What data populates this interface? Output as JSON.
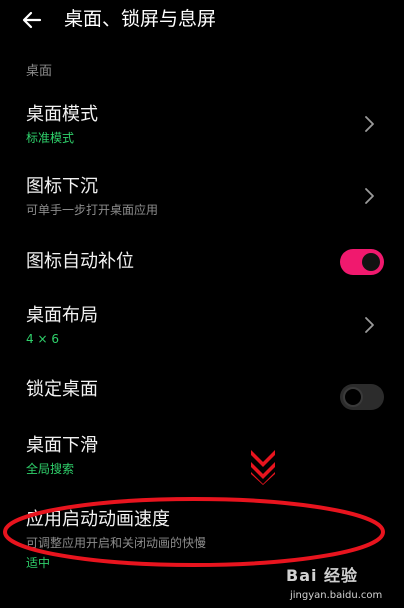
{
  "header": {
    "back_icon": "arrow-left-icon",
    "title": "桌面、锁屏与息屏"
  },
  "section": {
    "label": "桌面"
  },
  "settings": [
    {
      "title": "桌面模式",
      "subtitle": "标准模式",
      "control": "chevron-right-icon"
    },
    {
      "title": "图标下沉",
      "subtitle": "可单手一步打开桌面应用",
      "control": "chevron-right-icon"
    },
    {
      "title": "图标自动补位",
      "control": "toggle",
      "enabled": true
    },
    {
      "title": "桌面布局",
      "subtitle": "4 × 6",
      "control": "chevron-right-icon"
    },
    {
      "title": "锁定桌面",
      "control": "toggle",
      "enabled": false
    },
    {
      "title": "桌面下滑",
      "subtitle": "全局搜索",
      "control": "none"
    },
    {
      "title": "应用启动动画速度",
      "subtitle": "可调整应用开启和关闭动画的快慢",
      "value": "适中",
      "control": "none"
    }
  ],
  "watermark": {
    "line1": "Bai 经验",
    "line2": "jingyan.baidu.com"
  },
  "colors": {
    "background": "#000000",
    "accent_green": "#2fd16b",
    "toggle_on": "#f0196e",
    "annotation_red": "#e8141e"
  }
}
